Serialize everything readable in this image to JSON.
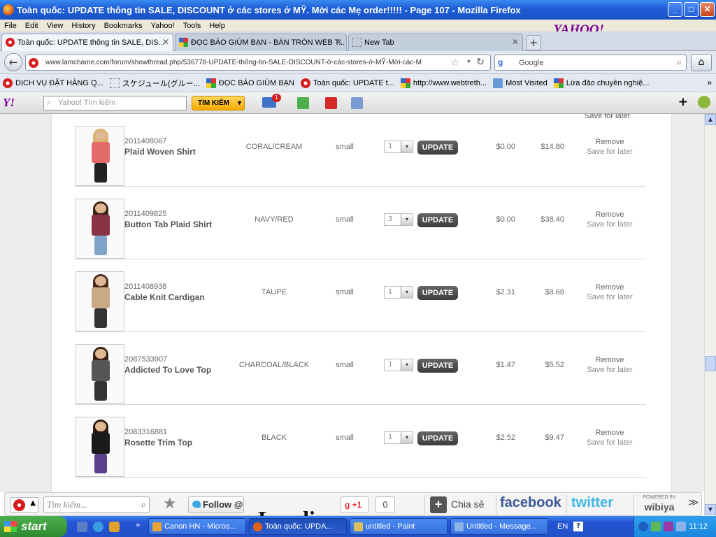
{
  "window": {
    "title": "Toàn quốc: UPDATE thông tin SALE, DISCOUNT ở các stores ở MỸ. Mời các Mẹ order!!!!! - Page 107 - Mozilla Firefox",
    "controls": {
      "minimize": "_",
      "maximize": "□",
      "close": "✕"
    }
  },
  "menu": [
    "File",
    "Edit",
    "View",
    "History",
    "Bookmarks",
    "Yahoo!",
    "Tools",
    "Help"
  ],
  "yahoo_brand": "YAHOO!",
  "tabs": [
    {
      "label": "Toàn quốc: UPDATE thông tin SALE, DIS...",
      "active": true,
      "close": "✕"
    },
    {
      "label": "ĐỌC BÁO GIÙM BẠN - BÀN TRÒN WEB T...",
      "active": false,
      "close": "✕"
    },
    {
      "label": "New Tab",
      "active": false,
      "close": "✕"
    }
  ],
  "new_tab": "+",
  "nav": {
    "back": "←",
    "url": "www.lamchame.com/forum/showthread.php/536778-UPDATE-thông-tin-SALE-DISCOUNT-ở-các-stores-ở-MỸ-Mời-các-M",
    "star": "☆",
    "dropdown": "▾",
    "reload": "↻",
    "search_engine": "g",
    "search_placeholder": "Google",
    "search_icon": "⌕",
    "home": "⌂"
  },
  "bookmarks": [
    {
      "label": "DỊCH VỤ ĐẶT HÀNG Q...",
      "icon": "lamchame-icon"
    },
    {
      "label": "スケジュール(グルー...",
      "icon": "page-icon"
    },
    {
      "label": "ĐỌC BÁO GIÙM BẠN",
      "icon": "webtretho-icon"
    },
    {
      "label": "Toàn quốc: UPDATE t...",
      "icon": "lamchame-icon"
    },
    {
      "label": "http://www.webtreth...",
      "icon": "webtretho-icon"
    },
    {
      "label": "Most Visited",
      "icon": "most-visited-icon"
    },
    {
      "label": "Lừa đảo chuyên nghiệ...",
      "icon": "webtretho-icon"
    }
  ],
  "bookmarks_more": "»",
  "yahoo_toolbar": {
    "logo": "Y!",
    "search_placeholder": "Yahoo! Tìm kiếm",
    "search_button": "TÌM KIẾM",
    "mail_count": "1",
    "plus": "+"
  },
  "cart": {
    "header_partial": "Save for later",
    "update_label": "UPDATE",
    "remove_label": "Remove",
    "save_label": "Save for later",
    "qty_arrow": "▾",
    "items": [
      {
        "sku": "2011408067",
        "name": "Plaid Woven Shirt",
        "color": "CORAL/CREAM",
        "size": "small",
        "qty": "1",
        "discount": "$0.00",
        "total": "$14.80",
        "hair": "#d9b36a",
        "top": "#e46a6a",
        "bottom": "#222"
      },
      {
        "sku": "2011409825",
        "name": "Button Tab Plaid Shirt",
        "color": "NAVY/RED",
        "size": "small",
        "qty": "3",
        "discount": "$0.00",
        "total": "$38.40",
        "hair": "#3b2418",
        "top": "#8a3344",
        "bottom": "#7fa4c9"
      },
      {
        "sku": "2011408938",
        "name": "Cable Knit Cardigan",
        "color": "TAUPE",
        "size": "small",
        "qty": "1",
        "discount": "$2.31",
        "total": "$8.68",
        "hair": "#4a2b1a",
        "top": "#c8aa86",
        "bottom": "#333"
      },
      {
        "sku": "2087533907",
        "name": "Addicted To Love Top",
        "color": "CHARCOAL/BLACK",
        "size": "small",
        "qty": "1",
        "discount": "$1.47",
        "total": "$5.52",
        "hair": "#3a2418",
        "top": "#555",
        "bottom": "#333"
      },
      {
        "sku": "2083316881",
        "name": "Rosette Trim Top",
        "color": "BLACK",
        "size": "small",
        "qty": "1",
        "discount": "$2.52",
        "total": "$9.47",
        "hair": "#2a1810",
        "top": "#1a1a1a",
        "bottom": "#5a3f8a"
      }
    ]
  },
  "share_bar": {
    "search_placeholder": "Tìm kiếm...",
    "follow": "Follow @",
    "big_text": "Laudi",
    "gplus": "g +1",
    "gplus_count": "0",
    "share": "Chia sẻ",
    "share_plus": "+",
    "facebook": "facebook",
    "twitter": "twitter",
    "powered": "POWERED BY",
    "wibiya": "wibiya",
    "collapse": "≫"
  },
  "taskbar": {
    "start": "start",
    "tasks": [
      {
        "label": "Canon HN - Micros...",
        "active": false,
        "color": "#e8a33a"
      },
      {
        "label": "Toàn quốc: UPDA...",
        "active": true,
        "color": "#e0611c"
      },
      {
        "label": "untitled - Paint",
        "active": false,
        "color": "#d8c060"
      },
      {
        "label": "Untitled - Message...",
        "active": false,
        "color": "#8ab4e8"
      }
    ],
    "lang": "EN",
    "help": "?",
    "time": "11:12"
  }
}
